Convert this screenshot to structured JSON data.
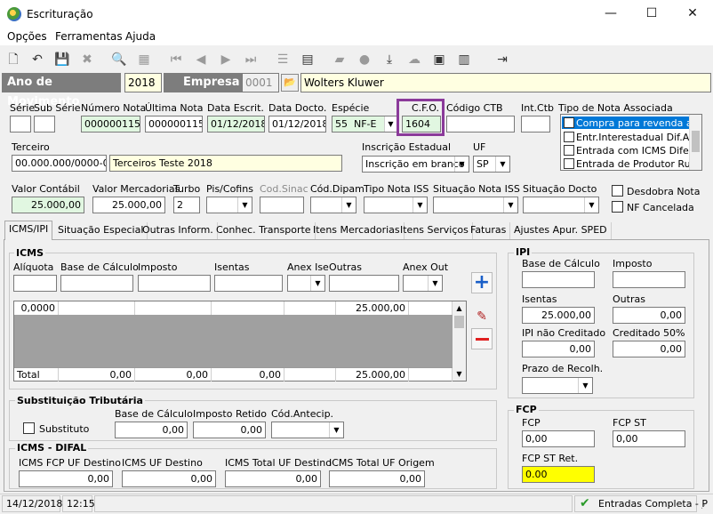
{
  "window": {
    "title": "Escrituração",
    "minimize": "—",
    "maximize": "☐",
    "close": "✕"
  },
  "menu": {
    "opcoes": "Opções",
    "ferramentas": "Ferramentas",
    "ajuda": "Ajuda"
  },
  "band": {
    "ano_label": "Ano de Movimento",
    "ano_value": "2018",
    "empresa_label": "Empresa",
    "empresa_code": "0001",
    "empresa_name": "Wolters Kluwer"
  },
  "row1": {
    "serie_label": "Série",
    "subserie_label": "Sub Série",
    "numero_nota_label": "Número Nota",
    "numero_nota": "0000001156",
    "ultima_nota_label": "Última Nota",
    "ultima_nota": "0000001156",
    "data_escrit_label": "Data Escrit.",
    "data_escrit": "01/12/2018",
    "data_docto_label": "Data Docto.",
    "data_docto": "01/12/2018",
    "especie_label": "Espécie",
    "especie_code": "55",
    "especie_value": "NF-E",
    "cfo_label": "C.F.O.",
    "cfo": "1604",
    "codigo_ctb_label": "Código CTB",
    "int_ctb_label": "Int.Ctb",
    "tipo_nota_label": "Tipo de Nota Associada",
    "tipo_nota_options": [
      "Compra para revenda a co",
      "Entr.Interestadual Dif.Aliq",
      "Entrada com ICMS Diferido",
      "Entrada de Produtor Rural"
    ]
  },
  "row2": {
    "terceiro_label": "Terceiro",
    "terceiro_cnpj": "00.000.000/0000-00",
    "terceiro_nome": "Terceiros Teste 2018",
    "inscricao_label": "Inscrição Estadual",
    "inscricao_value": "Inscrição em branco",
    "uf_label": "UF",
    "uf_value": "SP"
  },
  "row3": {
    "valor_contabil_label": "Valor Contábil",
    "valor_contabil": "25.000,00",
    "valor_mercadorias_label": "Valor Mercadorias",
    "valor_mercadorias": "25.000,00",
    "turbo_label": "Turbo",
    "turbo": "2",
    "pis_label": "Pis/Cofins",
    "cod_sinac_label": "Cod.Sinac",
    "cod_dipam_label": "Cód.Dipam",
    "tipo_iss_label": "Tipo Nota ISS",
    "situacao_iss_label": "Situação Nota ISS",
    "situacao_docto_label": "Situação Docto",
    "desdobra_label": "Desdobra Nota",
    "nf_cancelada_label": "NF Cancelada"
  },
  "tabs": [
    "ICMS/IPI",
    "Situação Especial",
    "Outras Inform.",
    "Conhec. Transporte",
    "Itens Mercadorias",
    "Itens Serviços",
    "Faturas",
    "Ajustes Apur. SPED"
  ],
  "icms": {
    "title": "ICMS",
    "aliquota_label": "Alíquota",
    "base_label": "Base de Cálculo",
    "imposto_label": "Imposto",
    "isentas_label": "Isentas",
    "anex_ise_label": "Anex Ise",
    "outras_label": "Outras",
    "anex_out_label": "Anex Out",
    "row_aliquota": "0,0000",
    "row_outras": "25.000,00",
    "total_label": "Total",
    "total_base": "0,00",
    "total_imposto": "0,00",
    "total_isentas": "0,00",
    "total_outras": "25.000,00"
  },
  "st": {
    "title": "Substituição Tributária",
    "substituto_label": "Substituto",
    "base_label": "Base de Cálculo",
    "base": "0,00",
    "retido_label": "Imposto Retido",
    "retido": "0,00",
    "antecip_label": "Cód.Antecip."
  },
  "difal": {
    "title": "ICMS - DIFAL",
    "fcp_label": "ICMS FCP UF Destino",
    "fcp": "0,00",
    "uf_destino_label": "ICMS UF Destino",
    "uf_destino": "0,00",
    "total_destino_label": "ICMS Total UF Destino",
    "total_destino": "0,00",
    "total_origem_label": "ICMS Total UF Origem",
    "total_origem": "0,00"
  },
  "ipi": {
    "title": "IPI",
    "base_label": "Base de Cálculo",
    "imposto_label": "Imposto",
    "isentas_label": "Isentas",
    "isentas": "25.000,00",
    "outras_label": "Outras",
    "outras": "0,00",
    "nao_creditado_label": "IPI não Creditado",
    "nao_creditado": "0,00",
    "creditado50_label": "Creditado 50%",
    "creditado50": "0,00",
    "prazo_label": "Prazo de Recolh."
  },
  "fcp": {
    "title": "FCP",
    "fcp_label": "FCP",
    "fcp": "0,00",
    "fcp_st_label": "FCP ST",
    "fcp_st": "0,00",
    "fcp_st_ret_label": "FCP ST Ret.",
    "fcp_st_ret": "0.00"
  },
  "status": {
    "date": "14/12/2018",
    "time": "12:15",
    "mode": "Entradas Completa - P"
  },
  "colors": {
    "band": "#7d7d7d",
    "green_field": "#e1f7e1",
    "yellow_field": "#ffffe1",
    "cfo_highlight": "#8b3a9a",
    "fcp_st_ret_bg": "#ffff00",
    "add_blue": "#1a5fc8",
    "remove_red": "#e02020"
  }
}
